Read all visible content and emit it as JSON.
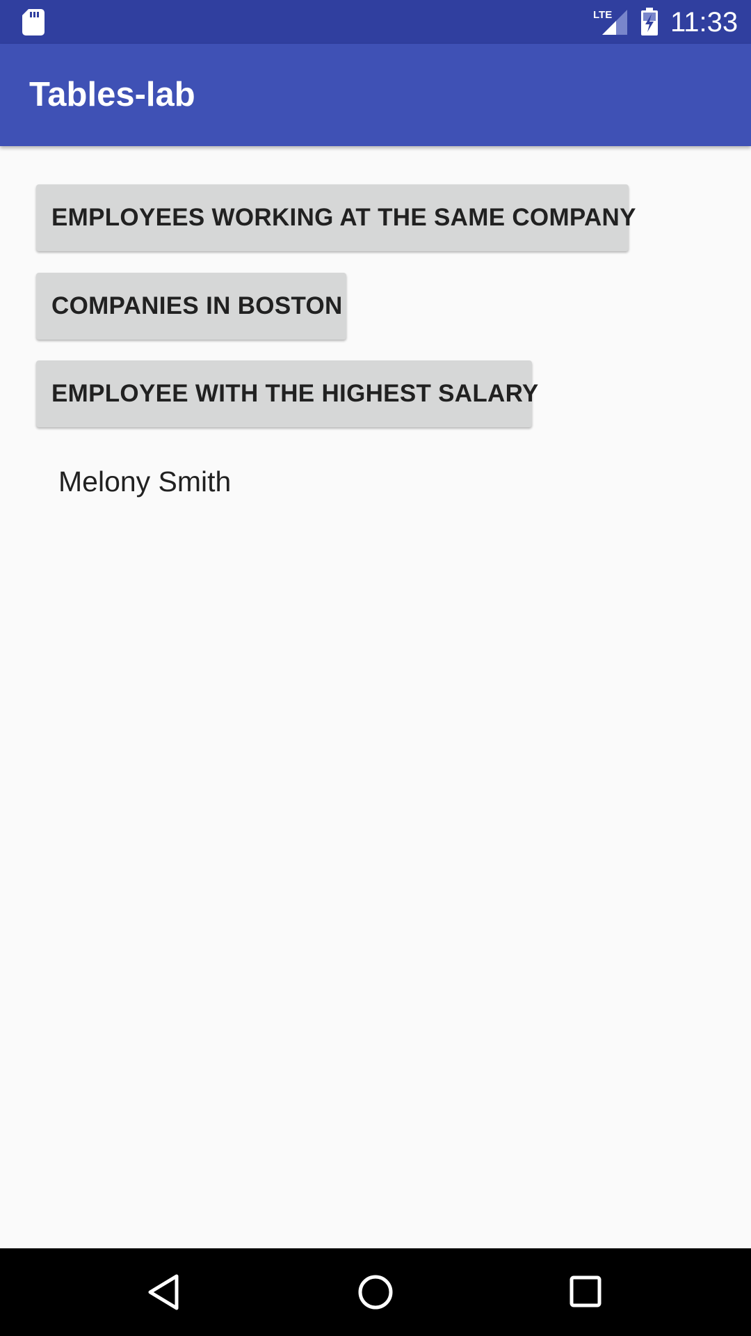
{
  "status_bar": {
    "time": "11:33",
    "network_label": "LTE",
    "icons": [
      "sd-card-icon",
      "lte-signal-icon",
      "battery-charging-icon"
    ],
    "background_color": "#303f9f"
  },
  "app_bar": {
    "title": "Tables-lab",
    "background_color": "#3f51b5"
  },
  "buttons": [
    {
      "label": "EMPLOYEES WORKING AT THE SAME COMPANY"
    },
    {
      "label": "COMPANIES IN BOSTON"
    },
    {
      "label": "EMPLOYEE WITH THE HIGHEST SALARY"
    }
  ],
  "result": {
    "text": "Melony Smith"
  },
  "nav_bar": {
    "icons": [
      "back-icon",
      "home-icon",
      "recents-icon"
    ]
  }
}
